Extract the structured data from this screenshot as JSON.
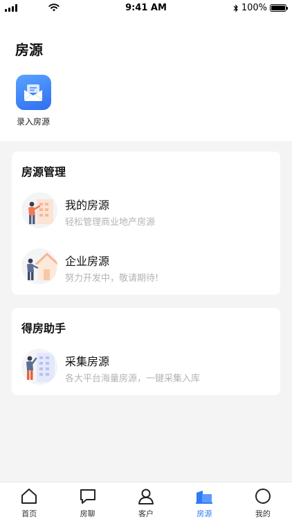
{
  "status_bar": {
    "time": "9:41 AM",
    "battery": "100%",
    "icons": [
      "signal-icon",
      "wifi-icon",
      "bluetooth-icon",
      "battery-icon"
    ]
  },
  "header": {
    "title": "房源"
  },
  "shortcuts": [
    {
      "label": "录入房源",
      "icon": "mail-icon",
      "color": "#3b7cf5"
    }
  ],
  "sections": [
    {
      "title": "房源管理",
      "items": [
        {
          "title": "我的房源",
          "subtitle": "轻松管理商业地产房源",
          "icon": "person-building-illustration"
        },
        {
          "title": "企业房源",
          "subtitle": "努力开发中，敬请期待!",
          "icon": "person-house-illustration"
        }
      ]
    },
    {
      "title": "得房助手",
      "items": [
        {
          "title": "采集房源",
          "subtitle": "各大平台海量房源，一键采集入库",
          "icon": "person-collect-illustration"
        }
      ]
    }
  ],
  "tab_bar": {
    "active_index": 3,
    "active_color": "#2f7af5",
    "tabs": [
      {
        "label": "首页",
        "icon": "home-icon"
      },
      {
        "label": "房聊",
        "icon": "chat-icon"
      },
      {
        "label": "客户",
        "icon": "user-icon"
      },
      {
        "label": "房源",
        "icon": "building-icon"
      },
      {
        "label": "我的",
        "icon": "circle-icon"
      }
    ]
  }
}
